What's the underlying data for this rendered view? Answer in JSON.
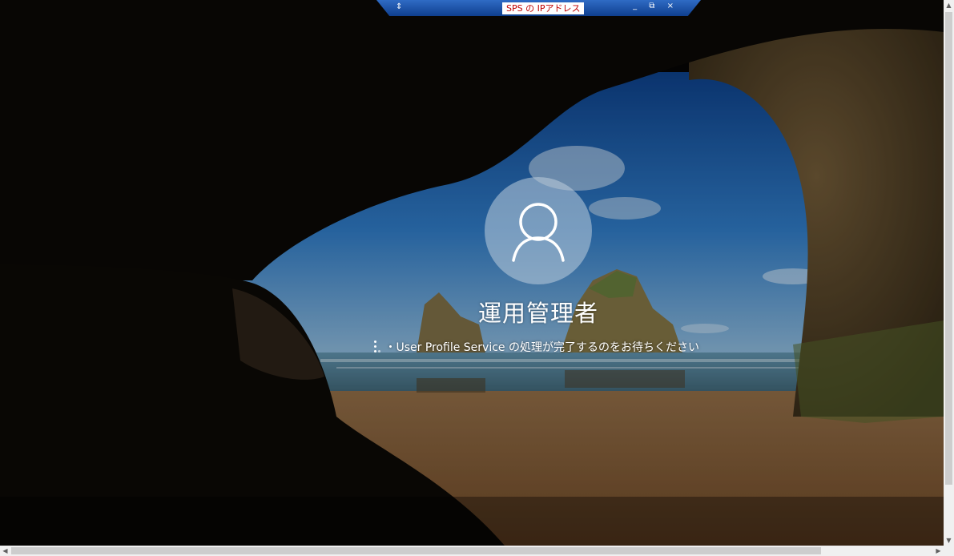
{
  "rdp_bar": {
    "title": "SPS の IPアドレス",
    "pin_icon": "pin-icon",
    "minimize_glyph": "_",
    "restore_glyph": "⧉",
    "close_glyph": "×"
  },
  "login": {
    "avatar_icon": "user-icon",
    "username": "運用管理者",
    "status_text": "・User Profile Service の処理が完了するのをお待ちください"
  },
  "scrollbars": {
    "v_up": "▲",
    "v_down": "▼",
    "h_left": "◀",
    "h_right": "▶"
  },
  "colors": {
    "rdp_bar": "#1f56a8",
    "rdp_title_text": "#c00000",
    "sky": "#1d5fa0",
    "sand": "#9a6a3a",
    "cave": "#0a0806"
  }
}
